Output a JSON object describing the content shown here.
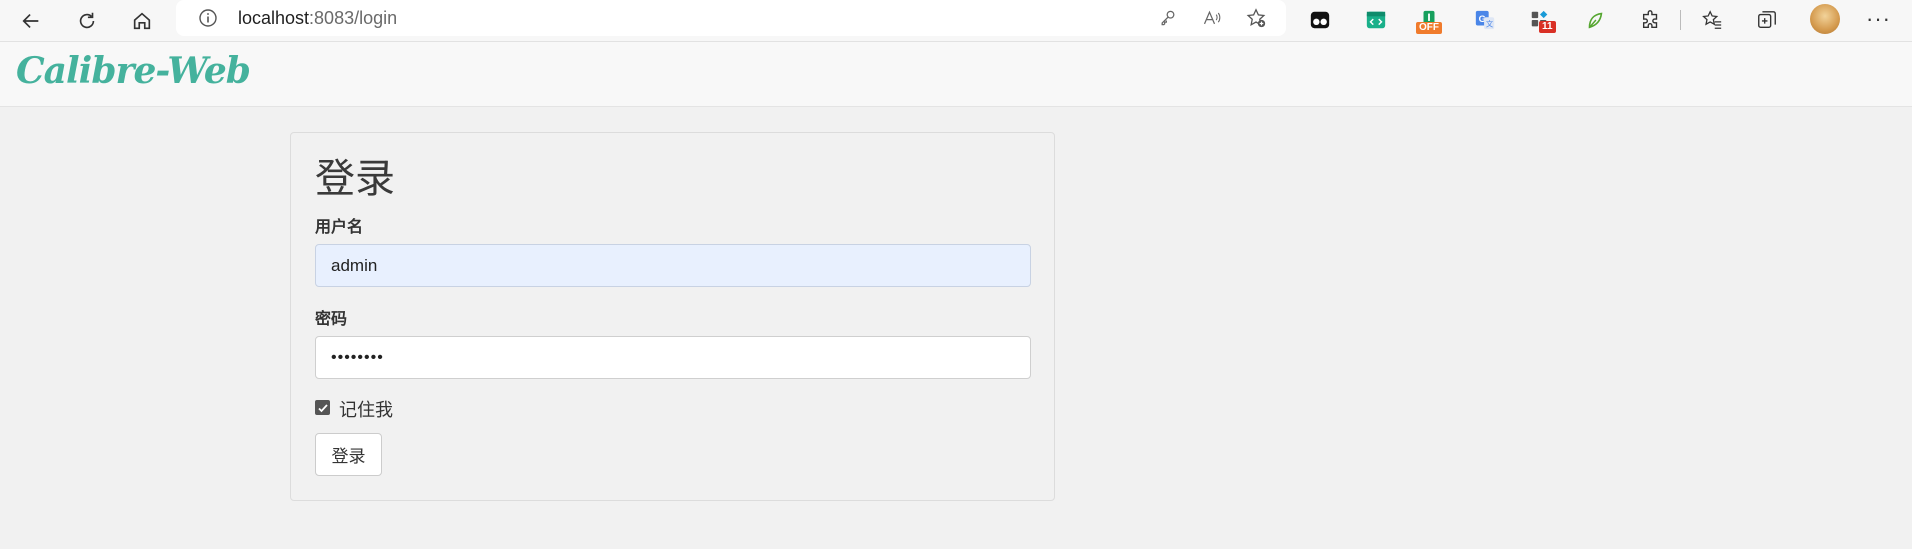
{
  "browser": {
    "url_host": "localhost",
    "url_port": ":8083",
    "url_path": "/login",
    "ext_offline_badge": "OFF",
    "ext_count_badge": "11",
    "more_label": "···"
  },
  "app": {
    "brand": "Calibre-Web"
  },
  "login": {
    "title": "登录",
    "username_label": "用户名",
    "username_value": "admin",
    "password_label": "密码",
    "password_value": "••••••••",
    "remember_label": "记住我",
    "remember_checked": true,
    "submit_label": "登录"
  },
  "colors": {
    "brand": "#45b29d",
    "autofill_bg": "#e8f0fe",
    "page_bg": "#f1f1f1"
  }
}
